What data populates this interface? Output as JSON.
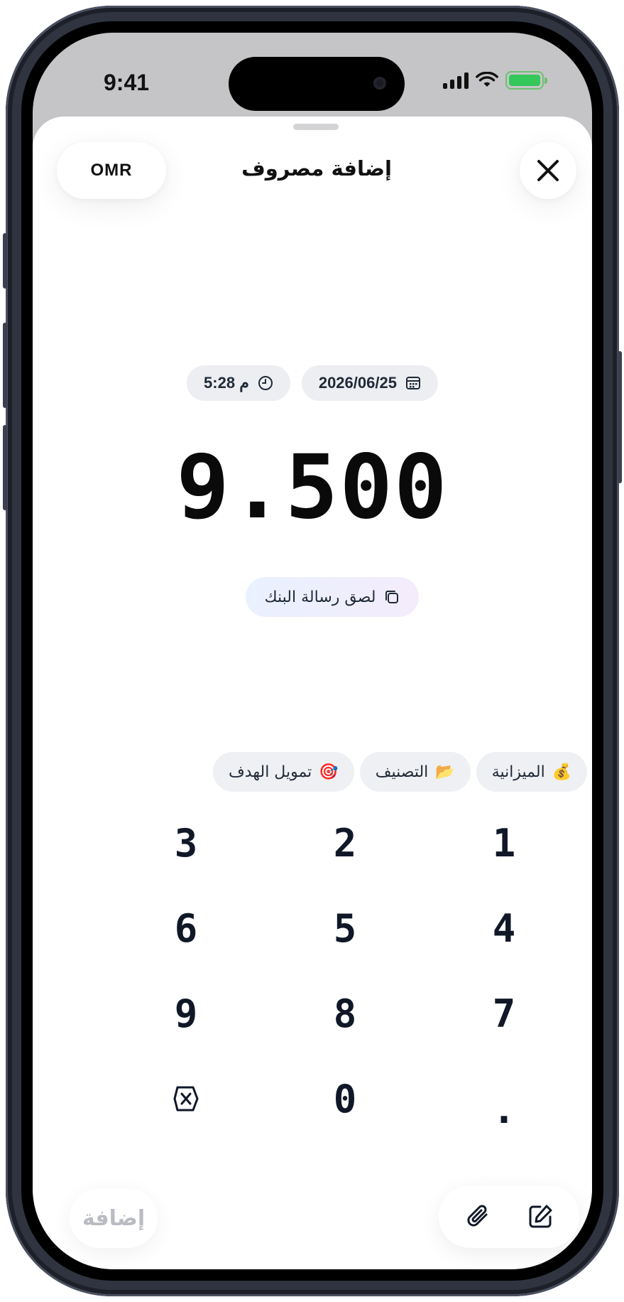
{
  "status_bar": {
    "time": "9:41"
  },
  "header": {
    "title": "إضافة مصروف",
    "currency": "OMR"
  },
  "date_time": {
    "date": "2026/06/25",
    "time": "5:28 م"
  },
  "amount": "9.500",
  "paste_button": "لصق رسالة البنك",
  "pills": [
    {
      "label": "تمويل الهدف",
      "icon": "🎯"
    },
    {
      "label": "التصنيف",
      "icon": "📂"
    },
    {
      "label": "الميزانية",
      "icon": "💰"
    }
  ],
  "keypad": [
    "3",
    "2",
    "1",
    "6",
    "5",
    "4",
    "9",
    "8",
    "7",
    "backspace",
    "0",
    "."
  ],
  "footer": {
    "add_label": "إضافة"
  },
  "colors": {
    "accent_paste_from": "#e9f1ff",
    "accent_paste_to": "#f4ecfb",
    "battery": "#34c759"
  }
}
